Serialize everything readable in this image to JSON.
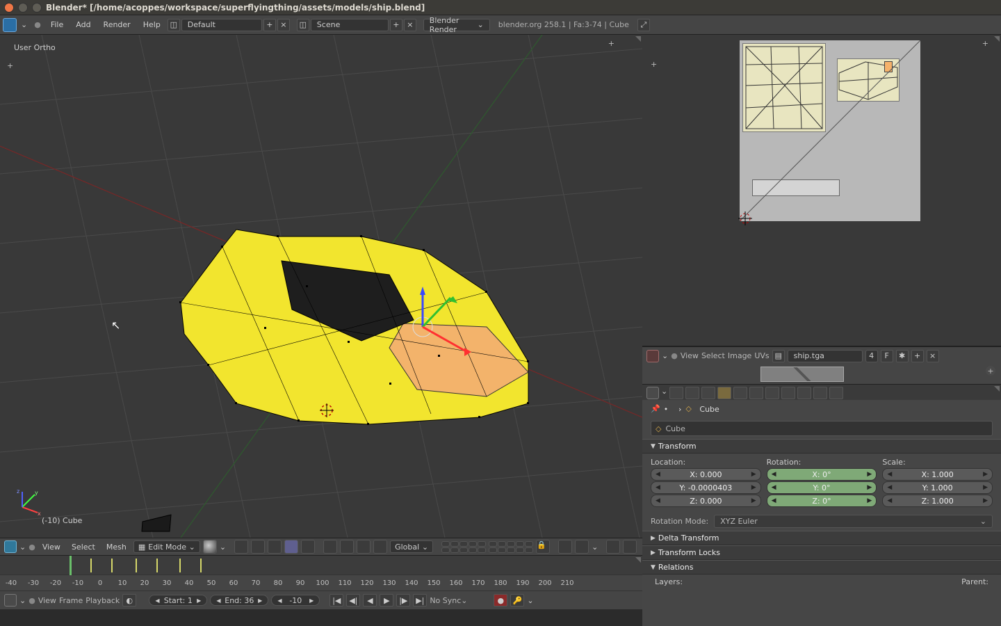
{
  "window": {
    "title": "Blender* [/home/acoppes/workspace/superflyingthing/assets/models/ship.blend]"
  },
  "infobar": {
    "menus": {
      "file": "File",
      "add": "Add",
      "render": "Render",
      "help": "Help"
    },
    "layout": "Default",
    "scene": "Scene",
    "renderer": "Blender Render",
    "stats": "blender.org 258.1 | Fa:3-74 | Cube"
  },
  "viewport": {
    "top_left_label": "User Ortho",
    "object_label": "(-10) Cube",
    "plus": "+"
  },
  "viewport_header": {
    "menus": {
      "view": "View",
      "select": "Select",
      "mesh": "Mesh"
    },
    "mode": "Edit Mode",
    "orientation": "Global"
  },
  "timeline": {
    "ruler": [
      "-40",
      "-30",
      "-20",
      "-10",
      "0",
      "10",
      "20",
      "30",
      "40",
      "50",
      "60",
      "70",
      "80",
      "90",
      "100",
      "110",
      "120",
      "130",
      "140",
      "150",
      "160",
      "170",
      "180",
      "190",
      "200",
      "210"
    ],
    "menus": {
      "view": "View",
      "frame": "Frame",
      "playback": "Playback"
    },
    "start_label": "Start: 1",
    "end_label": "End: 36",
    "current_label": "-10",
    "sync": "No Sync"
  },
  "uv": {
    "menus": {
      "view": "View",
      "select": "Select",
      "image": "Image",
      "uvs": "UVs"
    },
    "image_name": "ship.tga",
    "passes": "4",
    "flags": {
      "f": "F",
      "star": "✱"
    },
    "plus": "+"
  },
  "props": {
    "breadcrumb_item": "Cube",
    "name": "Cube",
    "panels": {
      "transform": "Transform",
      "delta": "Delta Transform",
      "locks": "Transform Locks",
      "relations": "Relations"
    },
    "transform": {
      "location_label": "Location:",
      "rotation_label": "Rotation:",
      "scale_label": "Scale:",
      "loc": {
        "x": "X: 0.000",
        "y": "Y: -0.0000403",
        "z": "Z: 0.000"
      },
      "rot": {
        "x": "X: 0°",
        "y": "Y: 0°",
        "z": "Z: 0°"
      },
      "scale": {
        "x": "X: 1.000",
        "y": "Y: 1.000",
        "z": "Z: 1.000"
      },
      "rotmode_label": "Rotation Mode:",
      "rotmode_value": "XYZ Euler"
    },
    "relations": {
      "layers": "Layers:",
      "parent": "Parent:"
    }
  }
}
